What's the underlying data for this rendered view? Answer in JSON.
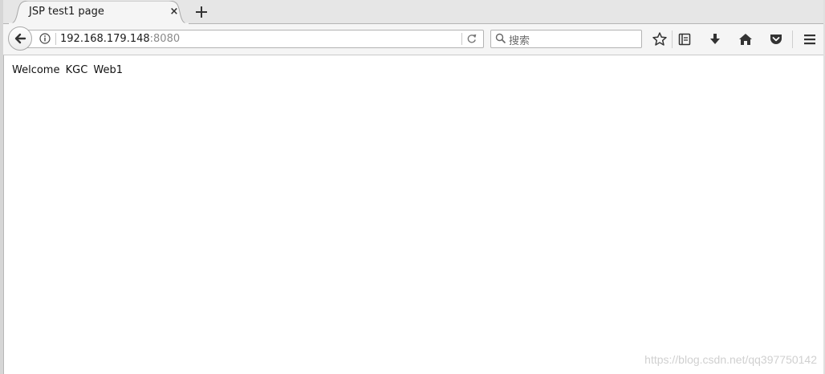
{
  "tab": {
    "title": "JSP test1 page",
    "close_glyph": "×",
    "new_tab_glyph": "+"
  },
  "navbar": {
    "url_host": "192.168.179.148",
    "url_port": ":8080",
    "search_placeholder": "搜索",
    "icons": [
      "back-arrow-icon",
      "info-icon",
      "reload-icon",
      "search-icon",
      "bookmark-star-icon",
      "reading-list-icon",
      "download-icon",
      "home-icon",
      "pocket-icon",
      "menu-icon"
    ]
  },
  "page": {
    "welcome_text": "Welcome KGC Web1"
  },
  "watermark": {
    "text": "https://blog.csdn.net/qq397750142"
  },
  "colors": {
    "tabstrip": "#e6e6e6",
    "navbar": "#f5f5f5",
    "content": "#ffffff"
  }
}
